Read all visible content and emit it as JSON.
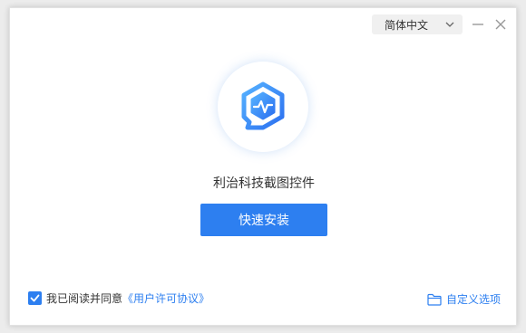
{
  "header": {
    "language": "简体中文"
  },
  "main": {
    "product_name": "利治科技截图控件",
    "install_label": "快速安装"
  },
  "footer": {
    "agree_text": "我已阅读并同意",
    "agree_link": "《用户许可协议》",
    "agree_checked": true,
    "custom_label": "自定义选项"
  },
  "colors": {
    "accent": "#2d7ff0",
    "background": "#ffffff"
  },
  "icons": [
    "chevron-down-icon",
    "minimize-icon",
    "close-icon",
    "app-logo-icon",
    "check-icon",
    "folder-icon"
  ]
}
